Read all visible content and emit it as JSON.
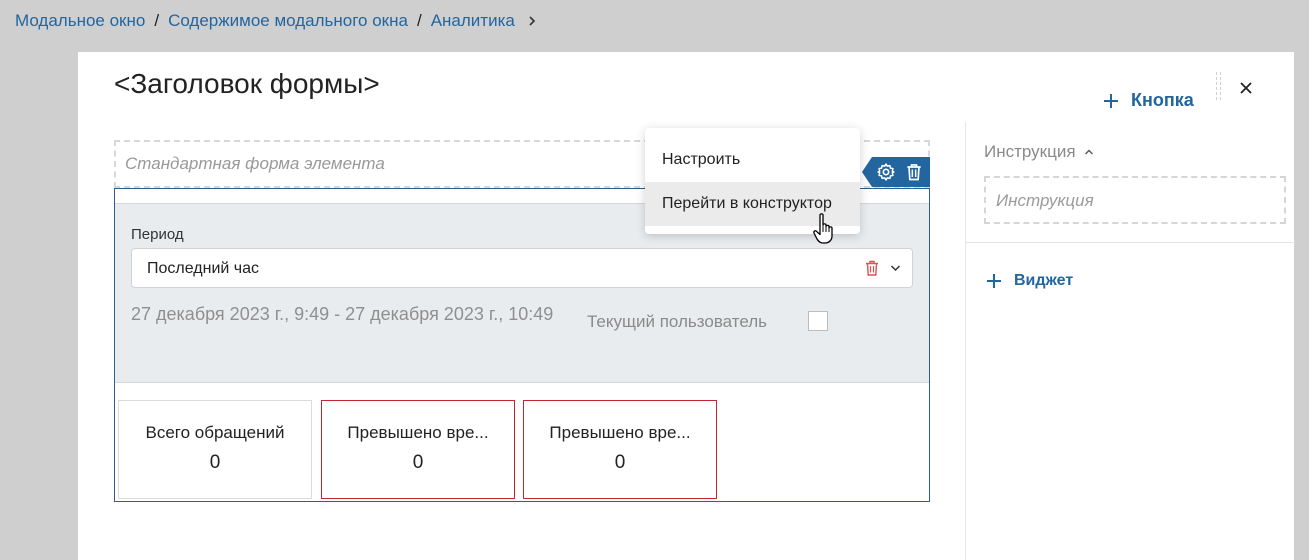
{
  "breadcrumb": {
    "items": [
      "Модальное окно",
      "Содержимое модального окна",
      "Аналитика"
    ],
    "separator": "/"
  },
  "modal": {
    "title": "<Заголовок формы>",
    "add_button_label": "Кнопка"
  },
  "form": {
    "standard_placeholder": "Стандартная форма элемента"
  },
  "widget": {
    "period_label": "Период",
    "period_value": "Последний час",
    "date_range": "27 декабря 2023 г., 9:49 - 27 декабря 2023 г., 10:49",
    "current_user_label": "Текущий пользователь",
    "cards": [
      {
        "title": "Всего обращений",
        "value": "0"
      },
      {
        "title": "Превышено вре...",
        "value": "0"
      },
      {
        "title": "Превышено вре...",
        "value": "0"
      }
    ]
  },
  "context_menu": {
    "items": [
      "Настроить",
      "Перейти в конструктор"
    ]
  },
  "right_panel": {
    "instruction_label": "Инструкция",
    "instruction_placeholder": "Инструкция",
    "add_widget_label": "Виджет"
  },
  "colors": {
    "accent": "#23659f",
    "alert_border": "#c0282d",
    "overlay": "#cfcfcf"
  }
}
